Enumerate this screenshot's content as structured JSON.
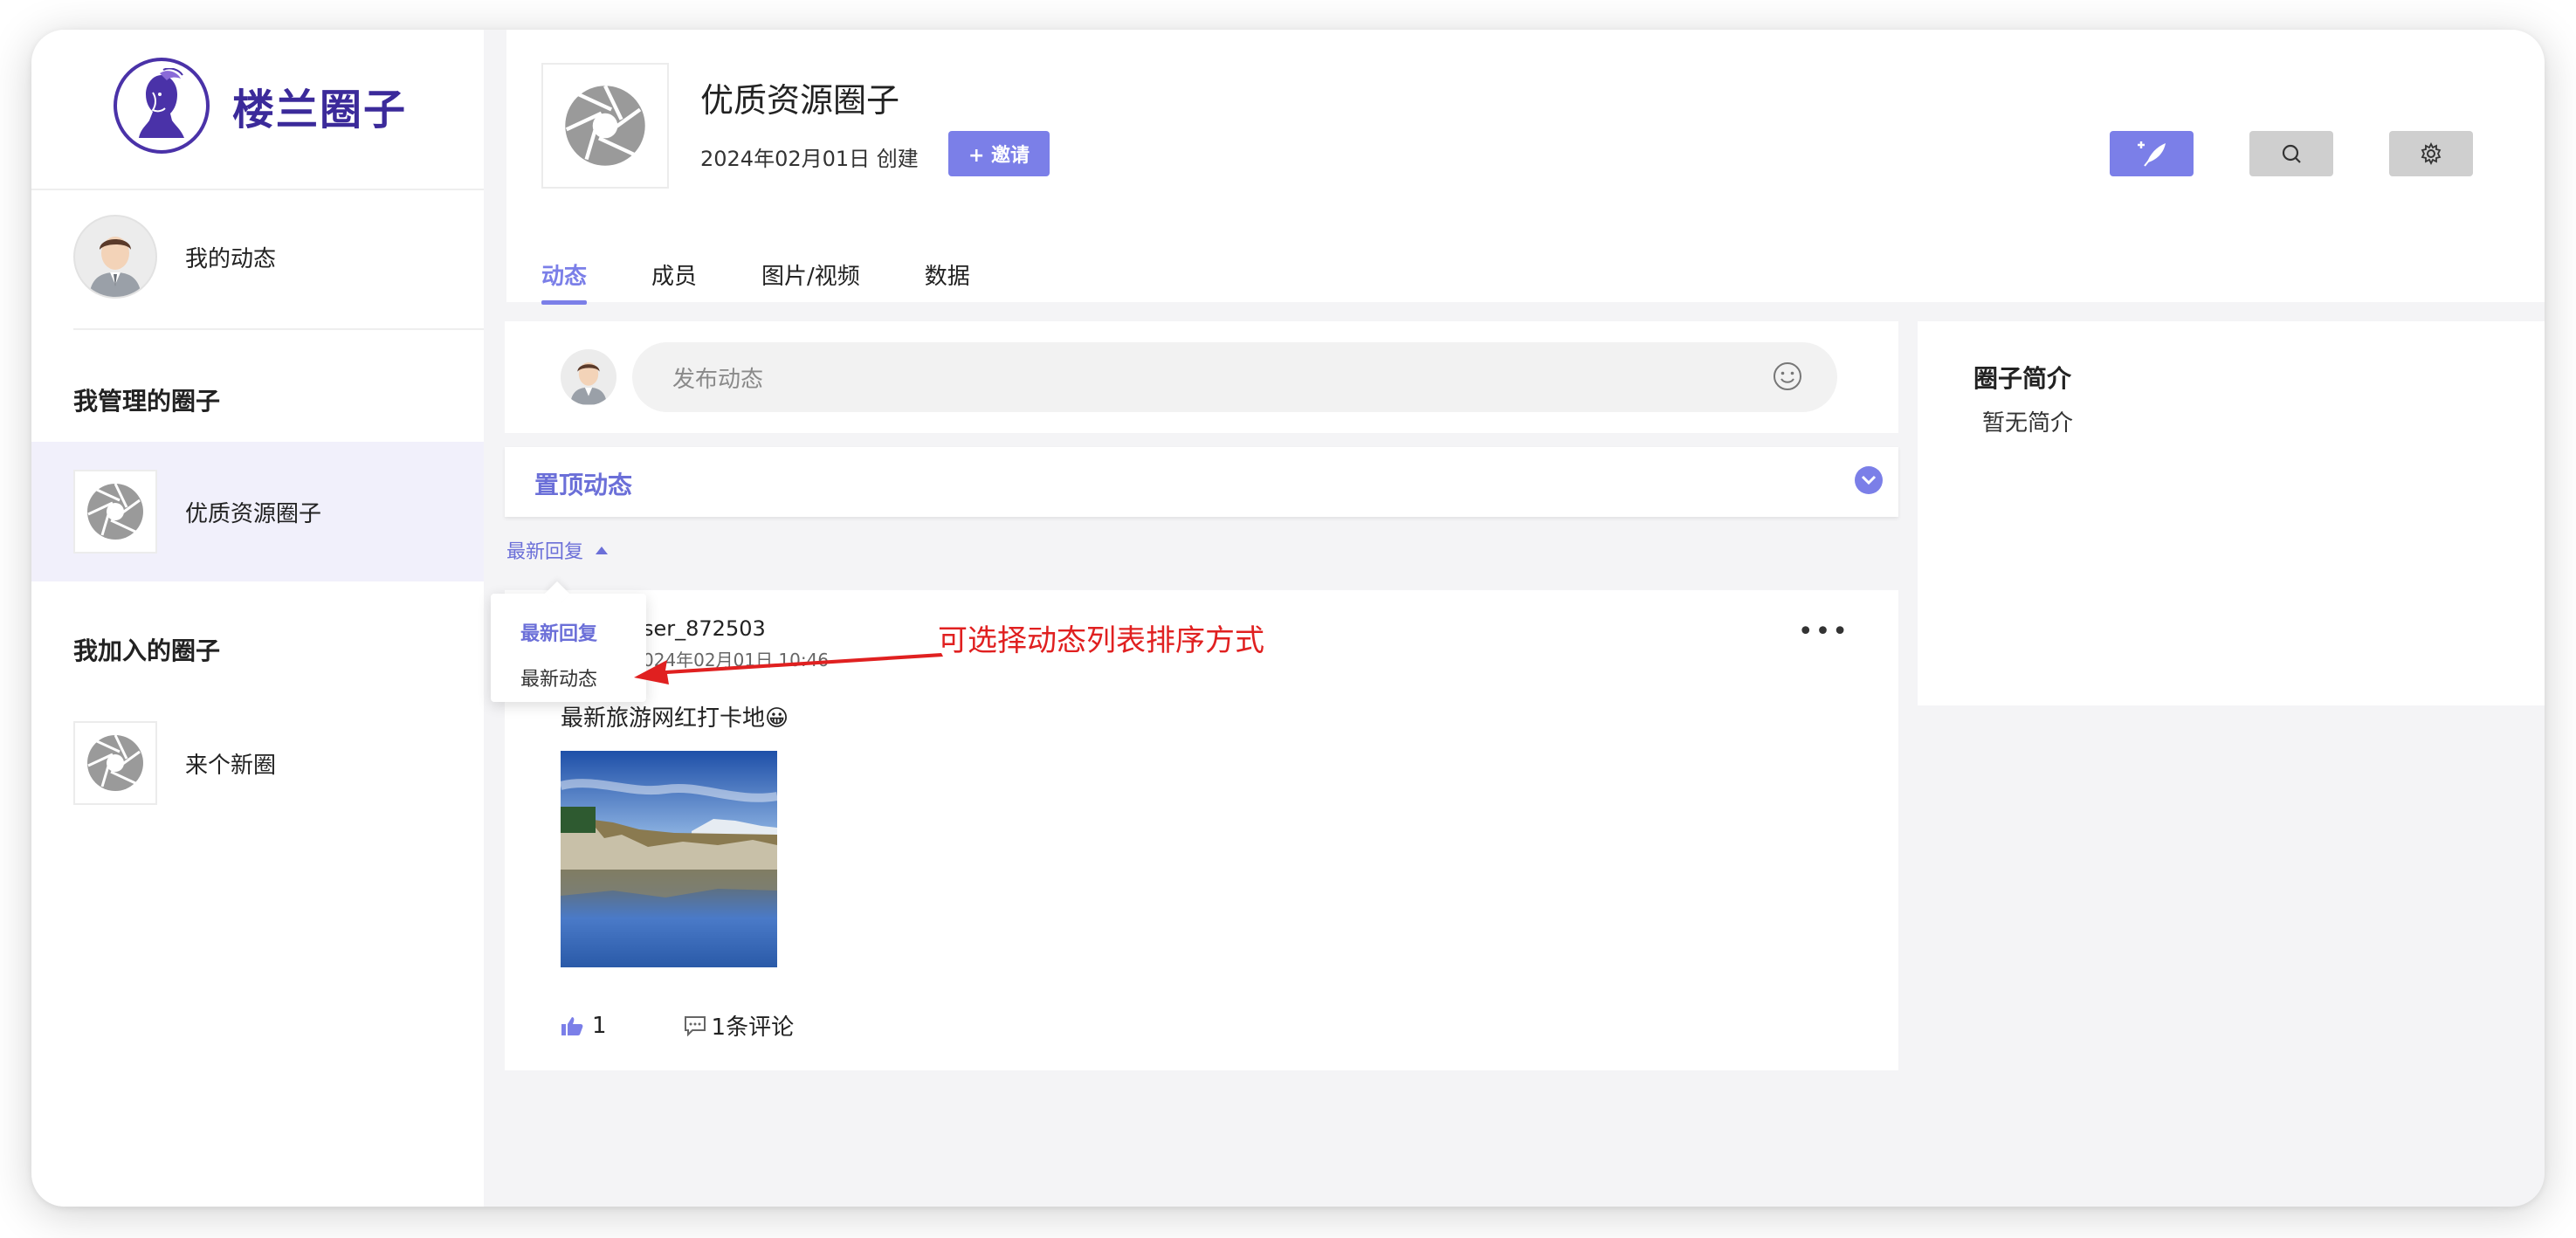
{
  "sidebar": {
    "brand_name": "楼兰圈子",
    "my_feed_label": "我的动态",
    "managed_title": "我管理的圈子",
    "managed": [
      {
        "name": "优质资源圈子"
      }
    ],
    "joined_title": "我加入的圈子",
    "joined": [
      {
        "name": "来个新圈"
      }
    ]
  },
  "header": {
    "title": "优质资源圈子",
    "created": "2024年02月01日 创建",
    "invite_label": "+ 邀请",
    "tabs": [
      {
        "label": "动态",
        "active": true
      },
      {
        "label": "成员"
      },
      {
        "label": "图片/视频"
      },
      {
        "label": "数据"
      }
    ]
  },
  "composer": {
    "placeholder": "发布动态"
  },
  "pinned": {
    "title": "置顶动态"
  },
  "sort": {
    "current": "最新回复",
    "options": [
      "最新回复",
      "最新动态"
    ]
  },
  "annotation": "可选择动态列表排序方式",
  "post": {
    "user": "ser_872503",
    "time": "024年02月01日 10:46",
    "text": "最新旅游网红打卡地😀",
    "likes": "1",
    "comments": "1条评论",
    "more": "•••"
  },
  "intro": {
    "title": "圈子简介",
    "body": "暂无简介"
  },
  "colors": {
    "accent": "#7b7fe8",
    "brand": "#3b2a9a",
    "annotation": "#e02020"
  }
}
